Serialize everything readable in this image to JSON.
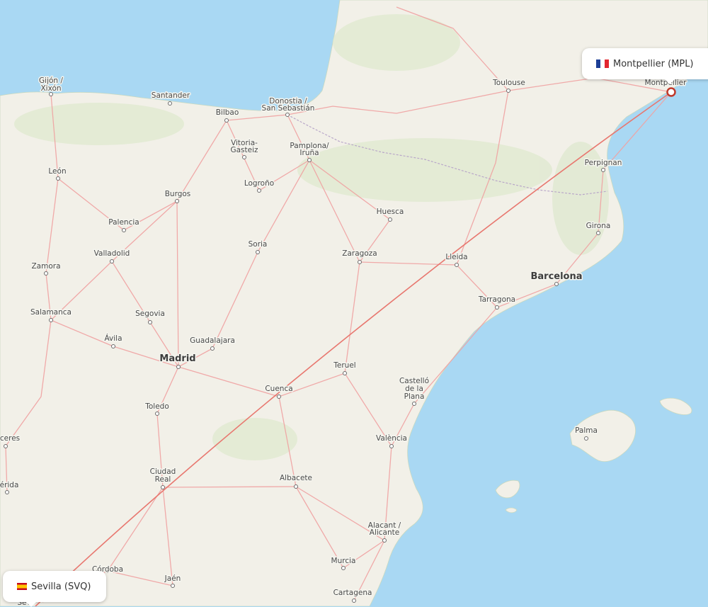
{
  "route": {
    "origin": {
      "city": "Sevilla",
      "code": "SVQ",
      "label": "Sevilla (SVQ)",
      "country_flag": "es-flag-icon"
    },
    "destination": {
      "city": "Montpellier",
      "code": "MPL",
      "label": "Montpellier (MPL)",
      "country_flag": "fr-flag-icon"
    },
    "line_color": "#e8776f"
  },
  "colors": {
    "sea": "#a9d8f3",
    "land": "#f2f0e8",
    "roads": "#f0a2a2"
  },
  "places": {
    "gijon": "Gijón /",
    "xixon": "Xixón",
    "santander": "Santander",
    "bilbao": "Bilbao",
    "donostia": "Donostia /",
    "san_sebastian": "San Sebastián",
    "vitoria": "Vitoria-",
    "gasteiz": "Gasteiz",
    "pamplona": "Pamplona/",
    "iruna": "Iruña",
    "toulouse": "Toulouse",
    "montpellier": "Montpellier",
    "leon": "León",
    "burgos": "Burgos",
    "logrono": "Logroño",
    "perpignan": "Perpignan",
    "palencia": "Palencia",
    "huesca": "Huesca",
    "girona": "Girona",
    "valladolid": "Valladolid",
    "soria": "Soria",
    "zaragoza": "Zaragoza",
    "lleida": "Lleida",
    "zamora": "Zamora",
    "barcelona": "Barcelona",
    "salamanca": "Salamanca",
    "segovia": "Segovia",
    "tarragona": "Tarragona",
    "avila": "Ávila",
    "guadalajara": "Guadalajara",
    "madrid": "Madrid",
    "teruel": "Teruel",
    "castello_1": "Castelló",
    "castello_2": "de la",
    "castello_3": "Plana",
    "cuenca": "Cuenca",
    "toledo": "Toledo",
    "caceres": "ceres",
    "valencia": "València",
    "palma": "Palma",
    "ciudad_real_1": "Ciudad",
    "ciudad_real_2": "Real",
    "albacete": "Albacete",
    "merida": "érida",
    "alacant_1": "Alacant /",
    "alacant_2": "Alicante",
    "murcia": "Murcia",
    "cordoba": "Córdoba",
    "jaen": "Jaén",
    "cartagena": "Cartagena",
    "sevilla_partial": "Sev"
  }
}
